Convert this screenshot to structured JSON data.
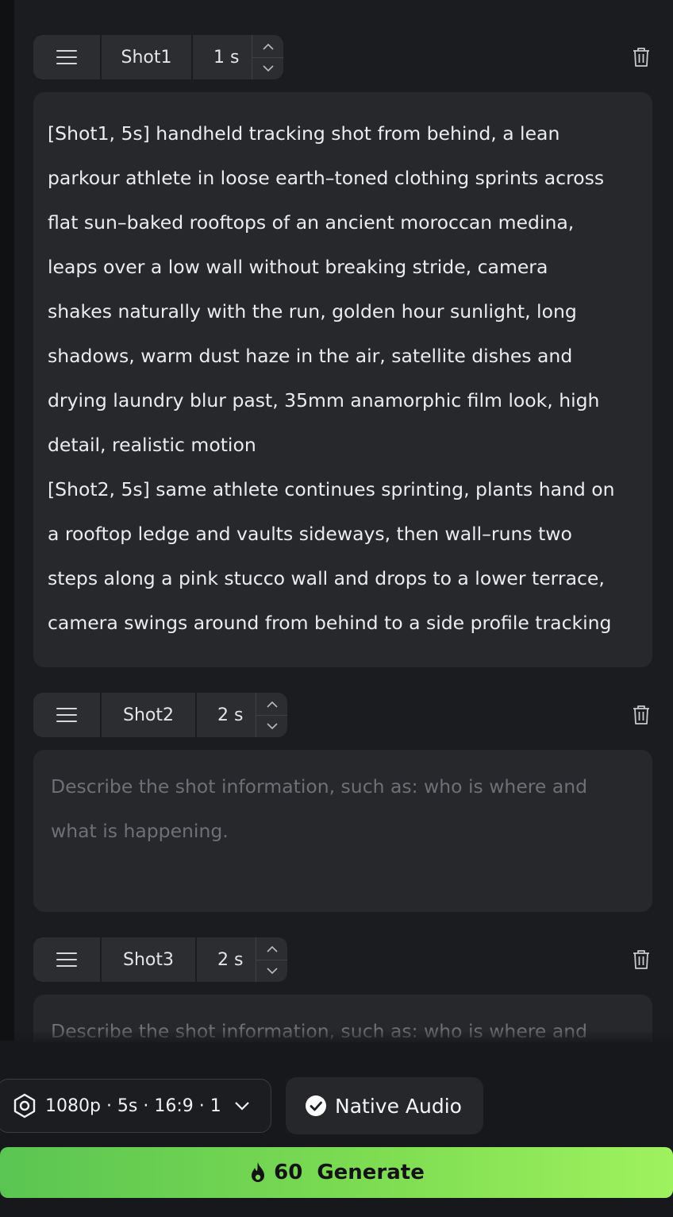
{
  "shots": [
    {
      "name": "Shot1",
      "duration": "1 s",
      "text": "[Shot1, 5s] handheld tracking shot from behind, a lean\nparkour athlete in loose earth–toned clothing sprints across\nflat sun–baked rooftops of an ancient moroccan medina,\nleaps over a low wall without breaking stride, camera\nshakes naturally with the run, golden hour sunlight, long\nshadows, warm dust haze in the air, satellite dishes and\ndrying laundry blur past, 35mm anamorphic film look, high\ndetail, realistic motion\n[Shot2, 5s] same athlete continues sprinting, plants hand on\na rooftop ledge and vaults sideways, then wall–runs two\nsteps along a pink stucco wall and drops to a lower terrace,\ncamera swings around from behind to a side profile tracking"
    },
    {
      "name": "Shot2",
      "duration": "2 s",
      "placeholder": "Describe the shot information, such as: who is where and\nwhat is happening."
    },
    {
      "name": "Shot3",
      "duration": "2 s",
      "placeholder": "Describe the shot information, such as: who is where and"
    }
  ],
  "settings": {
    "summary": "1080p · 5s · 16:9 · 1",
    "icon": "hexagon-settings-icon"
  },
  "audio": {
    "label": "Native Audio",
    "checked": true
  },
  "generate": {
    "cost": "60",
    "label": "Generate",
    "icon": "flame-icon",
    "gradient": [
      "#5ac552",
      "#9ff25e"
    ]
  },
  "colors": {
    "background": "#1b1c1f",
    "panel": "#27282c",
    "segment": "#2b2d31",
    "placeholder": "#6e7075"
  }
}
